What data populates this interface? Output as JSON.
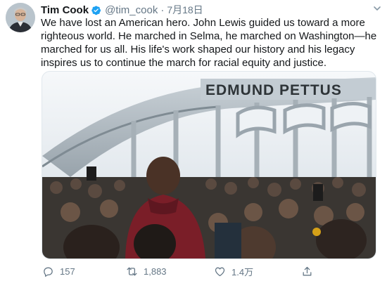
{
  "tweet": {
    "author_name": "Tim Cook",
    "handle": "@tim_cook",
    "separator": "·",
    "date": "7月18日",
    "text": "We have lost an American hero. John Lewis guided us toward a more righteous world. He marched in Selma, he marched on Washington—he marched for us all. His life's work shaped our history and his legacy inspires us to continue the march for racial equity and justice.",
    "photo_sign_text": "EDMUND PETTUS"
  },
  "actions": {
    "replies": "157",
    "retweets": "1,883",
    "likes": "1.4万",
    "reply_icon": "reply-icon",
    "retweet_icon": "retweet-icon",
    "like_icon": "heart-icon",
    "share_icon": "share-icon"
  },
  "colors": {
    "verified": "#1da1f2",
    "muted_text": "#657786",
    "text": "#14171a",
    "accent": "#1da1f2"
  }
}
